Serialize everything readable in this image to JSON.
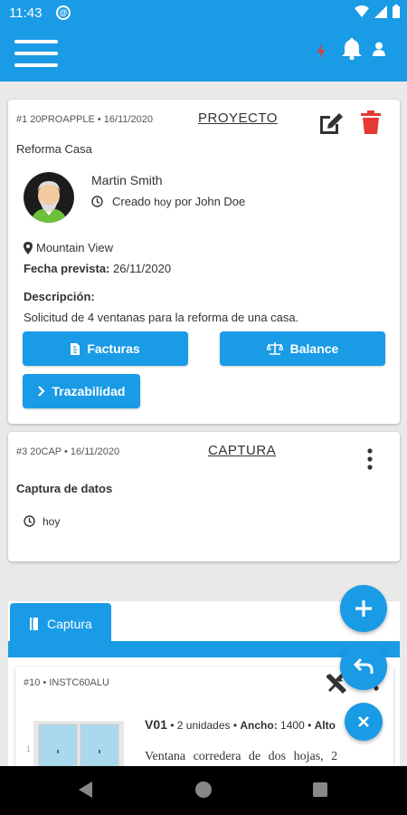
{
  "status": {
    "time": "11:43"
  },
  "card1": {
    "meta": "#1 20PROAPPLE • 16/11/2020",
    "title": "PROYECTO",
    "subtitle": "Reforma Casa",
    "person": "Martin Smith",
    "created_prefix": "Creado ",
    "created_when": "hoy",
    "created_suffix": " por John Doe",
    "location": "Mountain View",
    "date_label": "Fecha prevista:",
    "date_value": " 26/11/2020",
    "desc_label": "Descripción:",
    "desc_text": "Solicitud de 4 ventanas para la reforma de una casa.",
    "btn_facturas": "Facturas",
    "btn_balance": "Balance",
    "btn_trazabilidad": "Trazabilidad"
  },
  "card2": {
    "meta": "#3 20CAP • 16/11/2020",
    "title": "CAPTURA",
    "subtitle": "Captura de datos",
    "time": "hoy"
  },
  "panel": {
    "tab_label": "Captura",
    "item_meta": "#10 • INSTC60ALU",
    "item_code": "V01",
    "item_qty": " • 2 unidades • ",
    "item_ancho_label": "Ancho:",
    "item_ancho_value": " 1400 • ",
    "item_alto_label": "Alto",
    "item_desc": "Ventana corredera de dos hojas, 2"
  },
  "colors": {
    "primary": "#1a9be6",
    "delete": "#e53935"
  }
}
